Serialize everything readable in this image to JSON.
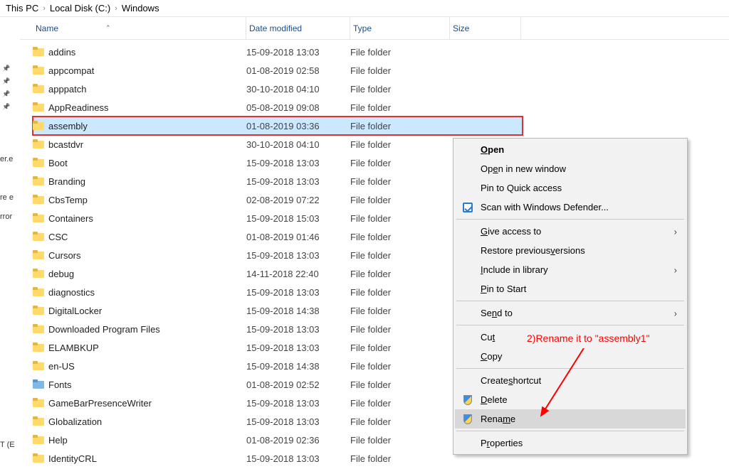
{
  "breadcrumb": {
    "items": [
      "This PC",
      "Local Disk (C:)",
      "Windows"
    ],
    "separator": "›"
  },
  "columns": {
    "name": "Name",
    "date": "Date modified",
    "type": "Type",
    "size": "Size"
  },
  "files": [
    {
      "name": "addins",
      "date": "15-09-2018 13:03",
      "type": "File folder"
    },
    {
      "name": "appcompat",
      "date": "01-08-2019 02:58",
      "type": "File folder"
    },
    {
      "name": "apppatch",
      "date": "30-10-2018 04:10",
      "type": "File folder"
    },
    {
      "name": "AppReadiness",
      "date": "05-08-2019 09:08",
      "type": "File folder"
    },
    {
      "name": "assembly",
      "date": "01-08-2019 03:36",
      "type": "File folder",
      "selected": true,
      "highlight": true
    },
    {
      "name": "bcastdvr",
      "date": "30-10-2018 04:10",
      "type": "File folder"
    },
    {
      "name": "Boot",
      "date": "15-09-2018 13:03",
      "type": "File folder"
    },
    {
      "name": "Branding",
      "date": "15-09-2018 13:03",
      "type": "File folder"
    },
    {
      "name": "CbsTemp",
      "date": "02-08-2019 07:22",
      "type": "File folder"
    },
    {
      "name": "Containers",
      "date": "15-09-2018 15:03",
      "type": "File folder"
    },
    {
      "name": "CSC",
      "date": "01-08-2019 01:46",
      "type": "File folder"
    },
    {
      "name": "Cursors",
      "date": "15-09-2018 13:03",
      "type": "File folder"
    },
    {
      "name": "debug",
      "date": "14-11-2018 22:40",
      "type": "File folder"
    },
    {
      "name": "diagnostics",
      "date": "15-09-2018 13:03",
      "type": "File folder"
    },
    {
      "name": "DigitalLocker",
      "date": "15-09-2018 14:38",
      "type": "File folder"
    },
    {
      "name": "Downloaded Program Files",
      "date": "15-09-2018 13:03",
      "type": "File folder"
    },
    {
      "name": "ELAMBKUP",
      "date": "15-09-2018 13:03",
      "type": "File folder"
    },
    {
      "name": "en-US",
      "date": "15-09-2018 14:38",
      "type": "File folder"
    },
    {
      "name": "Fonts",
      "date": "01-08-2019 02:52",
      "type": "File folder",
      "blue": true
    },
    {
      "name": "GameBarPresenceWriter",
      "date": "15-09-2018 13:03",
      "type": "File folder"
    },
    {
      "name": "Globalization",
      "date": "15-09-2018 13:03",
      "type": "File folder"
    },
    {
      "name": "Help",
      "date": "01-08-2019 02:36",
      "type": "File folder"
    },
    {
      "name": "IdentityCRL",
      "date": "15-09-2018 13:03",
      "type": "File folder"
    }
  ],
  "context_menu": {
    "open": "Open",
    "open_new": "Open in new window",
    "pin_quick": "Pin to Quick access",
    "scan_defender": "Scan with Windows Defender...",
    "give_access": "Give access to",
    "restore_prev": "Restore previous versions",
    "include_lib": "Include in library",
    "pin_start": "Pin to Start",
    "send_to": "Send to",
    "cut": "Cut",
    "copy": "Copy",
    "create_shortcut": "Create shortcut",
    "delete": "Delete",
    "rename": "Rename",
    "properties": "Properties"
  },
  "left_fragments": {
    "f1": "er.e",
    "f2": "re e",
    "f3": "rror",
    "f4": "T (E"
  },
  "annotation": "2)Rename it to \"assembly1\""
}
